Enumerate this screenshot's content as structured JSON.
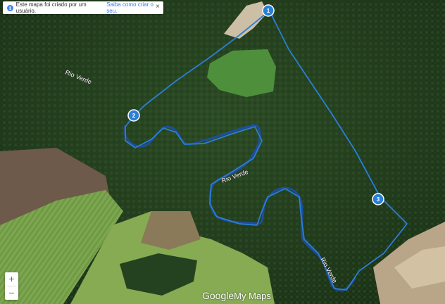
{
  "banner": {
    "info_icon": "info-icon",
    "text": "Este mapa foi criado por um usuário.",
    "link": "Saiba como criar o seu.",
    "close": "×"
  },
  "river_labels": [
    "Rio Verde",
    "Rio Verde",
    "Rio Verde"
  ],
  "route_color": "#2a7fd6",
  "river_color": "#1e4fa8",
  "markers": [
    {
      "label": "1"
    },
    {
      "label": "2"
    },
    {
      "label": "3"
    }
  ],
  "zoom": {
    "in": "+",
    "out": "−"
  },
  "branding": {
    "google": "Google",
    "mymaps": "My Maps"
  }
}
